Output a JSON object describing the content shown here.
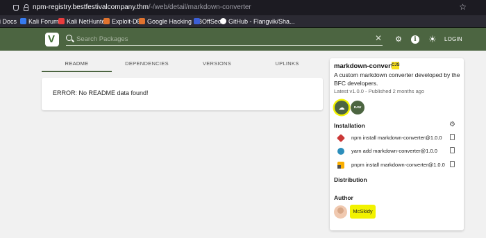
{
  "browser": {
    "url_host": "npm-registry.bestfestivalcompany.thm",
    "url_path": "/-/web/detail/markdown-converter",
    "bookmarks": [
      {
        "label": "li Docs",
        "color": "#367bf0"
      },
      {
        "label": "Kali Forums",
        "color": "#367bf0"
      },
      {
        "label": "Kali NetHunter",
        "color": "#e93c3c"
      },
      {
        "label": "Exploit-DB",
        "color": "#e0732e"
      },
      {
        "label": "Google Hacking DB",
        "color": "#e0732e"
      },
      {
        "label": "OffSec",
        "color": "#3c5fd6"
      },
      {
        "label": "GitHub - Flangvik/Sha...",
        "color": "#ffffff"
      }
    ]
  },
  "header": {
    "search_placeholder": "Search Packages",
    "login_label": "LOGIN",
    "icons": [
      "search-icon",
      "clear-icon",
      "settings-icon",
      "info-icon",
      "theme-icon"
    ]
  },
  "tabs": [
    "README",
    "DEPENDENCIES",
    "VERSIONS",
    "UPLINKS"
  ],
  "readme": {
    "message": "ERROR: No README data found!"
  },
  "package": {
    "name": "markdown-converter",
    "module_badge": "CJS",
    "description": "A custom markdown converter developed by the BFC developers.",
    "latest": "Latest v1.0.0 - Published 2 months ago",
    "raw_label": "RAW",
    "highlight_color": "#f2f200",
    "accent_color": "#4c6541"
  },
  "installation": {
    "title": "Installation",
    "commands": [
      {
        "manager": "npm",
        "icon": "npm-icon",
        "command": "npm install markdown-converter@1.0.0"
      },
      {
        "manager": "yarn",
        "icon": "yarn-icon",
        "command": "yarn add markdown-converter@1.0.0"
      },
      {
        "manager": "pnpm",
        "icon": "pnpm-icon",
        "command": "pnpm install markdown-converter@1.0.0"
      }
    ]
  },
  "distribution": {
    "title": "Distribution"
  },
  "author": {
    "title": "Author",
    "name": "McSkidy"
  }
}
